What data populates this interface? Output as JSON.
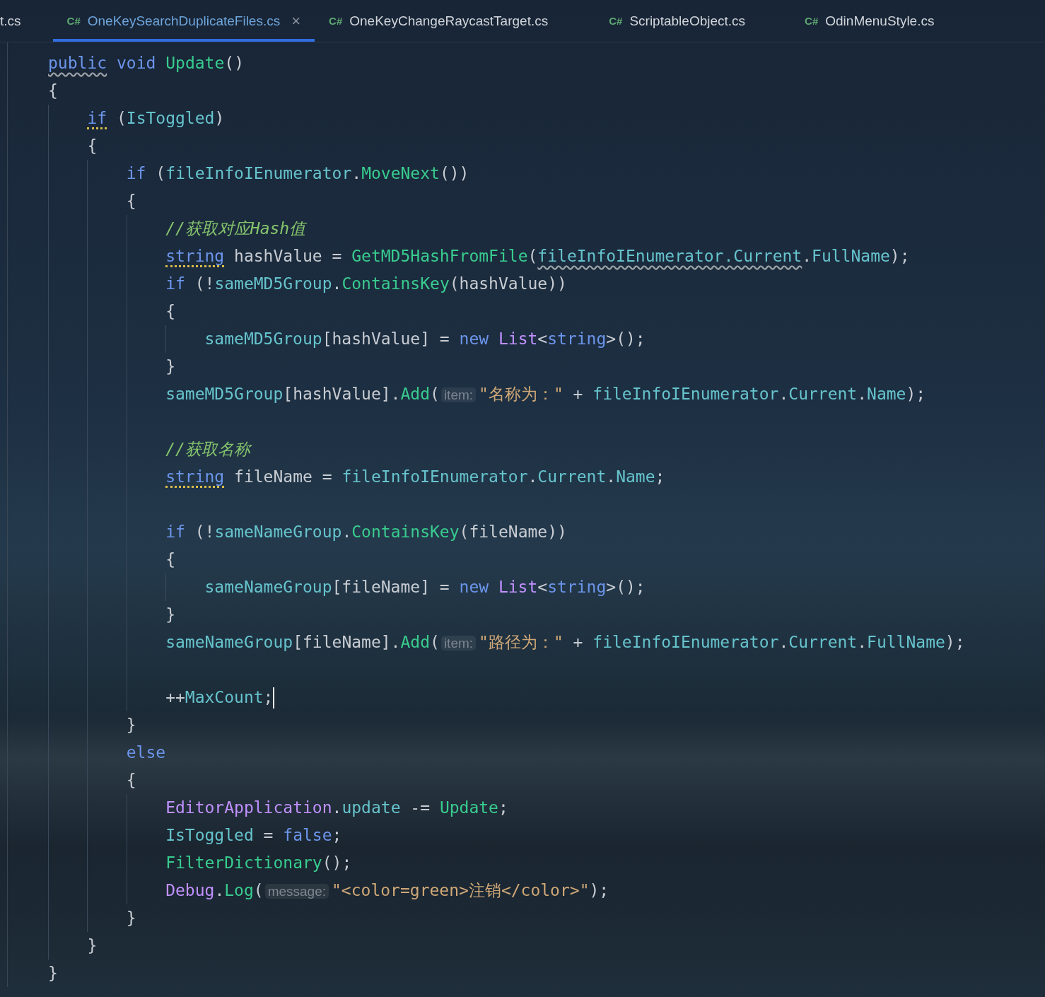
{
  "tabs": [
    {
      "label": "t.cs",
      "selected": false
    },
    {
      "lang": "C#",
      "label": "OneKeySearchDuplicateFiles.cs",
      "selected": true,
      "close": "×"
    },
    {
      "lang": "C#",
      "label": "OneKeyChangeRaycastTarget.cs",
      "selected": false
    },
    {
      "lang": "C#",
      "label": "ScriptableObject.cs",
      "selected": false
    },
    {
      "lang": "C#",
      "label": "OdinMenuStyle.cs",
      "selected": false
    }
  ],
  "code": [
    {
      "kind": "line",
      "tokens": [
        {
          "kind": "kw",
          "text": "public",
          "squiggly": true
        },
        {
          "kind": "kw",
          "text": " void"
        },
        {
          "kind": "method",
          "text": " Update"
        },
        {
          "kind": "plain",
          "text": "()"
        }
      ]
    },
    {
      "kind": "line",
      "tokens": [
        {
          "kind": "plain",
          "text": "{"
        }
      ]
    },
    {
      "kind": "block",
      "children": [
        {
          "kind": "line",
          "tokens": [
            {
              "kind": "kw",
              "text": "if",
              "dotted": true
            },
            {
              "kind": "plain",
              "text": " ("
            },
            {
              "kind": "field",
              "text": "IsToggled"
            },
            {
              "kind": "plain",
              "text": ")"
            }
          ]
        },
        {
          "kind": "line",
          "tokens": [
            {
              "kind": "plain",
              "text": "{"
            }
          ]
        },
        {
          "kind": "block",
          "children": [
            {
              "kind": "line",
              "tokens": [
                {
                  "kind": "kw",
                  "text": "if"
                },
                {
                  "kind": "plain",
                  "text": " ("
                },
                {
                  "kind": "field",
                  "text": "fileInfoIEnumerator"
                },
                {
                  "kind": "plain",
                  "text": "."
                },
                {
                  "kind": "method",
                  "text": "MoveNext"
                },
                {
                  "kind": "plain",
                  "text": "())"
                }
              ]
            },
            {
              "kind": "line",
              "tokens": [
                {
                  "kind": "plain",
                  "text": "{"
                }
              ]
            },
            {
              "kind": "block",
              "children": [
                {
                  "kind": "line",
                  "tokens": [
                    {
                      "kind": "comment",
                      "text": "//获取对应Hash值"
                    }
                  ]
                },
                {
                  "kind": "line",
                  "tokens": [
                    {
                      "kind": "kw",
                      "text": "string",
                      "dotted": true
                    },
                    {
                      "kind": "plain",
                      "text": " hashValue = "
                    },
                    {
                      "kind": "method",
                      "text": "GetMD5HashFromFile"
                    },
                    {
                      "kind": "plain",
                      "text": "("
                    },
                    {
                      "kind": "field",
                      "text": "fileInfoIEnumerator.Current",
                      "squiggly": true
                    },
                    {
                      "kind": "plain",
                      "text": "."
                    },
                    {
                      "kind": "field",
                      "text": "FullName"
                    },
                    {
                      "kind": "plain",
                      "text": ");"
                    }
                  ]
                },
                {
                  "kind": "line",
                  "tokens": [
                    {
                      "kind": "kw",
                      "text": "if"
                    },
                    {
                      "kind": "plain",
                      "text": " (!"
                    },
                    {
                      "kind": "field",
                      "text": "sameMD5Group"
                    },
                    {
                      "kind": "plain",
                      "text": "."
                    },
                    {
                      "kind": "method",
                      "text": "ContainsKey"
                    },
                    {
                      "kind": "plain",
                      "text": "(hashValue))"
                    }
                  ]
                },
                {
                  "kind": "line",
                  "tokens": [
                    {
                      "kind": "plain",
                      "text": "{"
                    }
                  ]
                },
                {
                  "kind": "block",
                  "children": [
                    {
                      "kind": "line",
                      "tokens": [
                        {
                          "kind": "field",
                          "text": "sameMD5Group"
                        },
                        {
                          "kind": "plain",
                          "text": "[hashValue] = "
                        },
                        {
                          "kind": "kw",
                          "text": "new"
                        },
                        {
                          "kind": "type",
                          "text": " List"
                        },
                        {
                          "kind": "plain",
                          "text": "<"
                        },
                        {
                          "kind": "kw",
                          "text": "string"
                        },
                        {
                          "kind": "plain",
                          "text": ">();"
                        }
                      ]
                    }
                  ]
                },
                {
                  "kind": "line",
                  "tokens": [
                    {
                      "kind": "plain",
                      "text": "}"
                    }
                  ]
                },
                {
                  "kind": "line",
                  "tokens": [
                    {
                      "kind": "field",
                      "text": "sameMD5Group"
                    },
                    {
                      "kind": "plain",
                      "text": "[hashValue]."
                    },
                    {
                      "kind": "method",
                      "text": "Add"
                    },
                    {
                      "kind": "plain",
                      "text": "("
                    },
                    {
                      "kind": "hint",
                      "text": "item:"
                    },
                    {
                      "kind": "str",
                      "text": "\"名称为：\""
                    },
                    {
                      "kind": "plain",
                      "text": " + "
                    },
                    {
                      "kind": "field",
                      "text": "fileInfoIEnumerator"
                    },
                    {
                      "kind": "plain",
                      "text": "."
                    },
                    {
                      "kind": "field",
                      "text": "Current"
                    },
                    {
                      "kind": "plain",
                      "text": "."
                    },
                    {
                      "kind": "field",
                      "text": "Name"
                    },
                    {
                      "kind": "plain",
                      "text": ");"
                    }
                  ]
                },
                {
                  "kind": "blank"
                },
                {
                  "kind": "line",
                  "tokens": [
                    {
                      "kind": "comment",
                      "text": "//获取名称"
                    }
                  ]
                },
                {
                  "kind": "line",
                  "tokens": [
                    {
                      "kind": "kw",
                      "text": "string",
                      "dotted": true
                    },
                    {
                      "kind": "plain",
                      "text": " fileName = "
                    },
                    {
                      "kind": "field",
                      "text": "fileInfoIEnumerator"
                    },
                    {
                      "kind": "plain",
                      "text": "."
                    },
                    {
                      "kind": "field",
                      "text": "Current"
                    },
                    {
                      "kind": "plain",
                      "text": "."
                    },
                    {
                      "kind": "field",
                      "text": "Name"
                    },
                    {
                      "kind": "plain",
                      "text": ";"
                    }
                  ]
                },
                {
                  "kind": "blank"
                },
                {
                  "kind": "line",
                  "tokens": [
                    {
                      "kind": "kw",
                      "text": "if"
                    },
                    {
                      "kind": "plain",
                      "text": " (!"
                    },
                    {
                      "kind": "field",
                      "text": "sameNameGroup"
                    },
                    {
                      "kind": "plain",
                      "text": "."
                    },
                    {
                      "kind": "method",
                      "text": "ContainsKey"
                    },
                    {
                      "kind": "plain",
                      "text": "(fileName))"
                    }
                  ]
                },
                {
                  "kind": "line",
                  "tokens": [
                    {
                      "kind": "plain",
                      "text": "{"
                    }
                  ]
                },
                {
                  "kind": "block",
                  "children": [
                    {
                      "kind": "line",
                      "tokens": [
                        {
                          "kind": "field",
                          "text": "sameNameGroup"
                        },
                        {
                          "kind": "plain",
                          "text": "[fileName] = "
                        },
                        {
                          "kind": "kw",
                          "text": "new"
                        },
                        {
                          "kind": "type",
                          "text": " List"
                        },
                        {
                          "kind": "plain",
                          "text": "<"
                        },
                        {
                          "kind": "kw",
                          "text": "string"
                        },
                        {
                          "kind": "plain",
                          "text": ">();"
                        }
                      ]
                    }
                  ]
                },
                {
                  "kind": "line",
                  "tokens": [
                    {
                      "kind": "plain",
                      "text": "}"
                    }
                  ]
                },
                {
                  "kind": "line",
                  "tokens": [
                    {
                      "kind": "field",
                      "text": "sameNameGroup"
                    },
                    {
                      "kind": "plain",
                      "text": "[fileName]."
                    },
                    {
                      "kind": "method",
                      "text": "Add"
                    },
                    {
                      "kind": "plain",
                      "text": "("
                    },
                    {
                      "kind": "hint",
                      "text": "item:"
                    },
                    {
                      "kind": "str",
                      "text": "\"路径为：\""
                    },
                    {
                      "kind": "plain",
                      "text": " + "
                    },
                    {
                      "kind": "field",
                      "text": "fileInfoIEnumerator"
                    },
                    {
                      "kind": "plain",
                      "text": "."
                    },
                    {
                      "kind": "field",
                      "text": "Current"
                    },
                    {
                      "kind": "plain",
                      "text": "."
                    },
                    {
                      "kind": "field",
                      "text": "FullName"
                    },
                    {
                      "kind": "plain",
                      "text": ");"
                    }
                  ]
                },
                {
                  "kind": "blank"
                },
                {
                  "kind": "line",
                  "caret": true,
                  "tokens": [
                    {
                      "kind": "plain",
                      "text": "++"
                    },
                    {
                      "kind": "field",
                      "text": "MaxCount"
                    },
                    {
                      "kind": "plain",
                      "text": ";"
                    }
                  ]
                }
              ]
            },
            {
              "kind": "line",
              "tokens": [
                {
                  "kind": "plain",
                  "text": "}"
                }
              ]
            },
            {
              "kind": "line",
              "tokens": [
                {
                  "kind": "kw",
                  "text": "else"
                }
              ]
            },
            {
              "kind": "line",
              "tokens": [
                {
                  "kind": "plain",
                  "text": "{"
                }
              ]
            },
            {
              "kind": "block",
              "children": [
                {
                  "kind": "line",
                  "tokens": [
                    {
                      "kind": "type",
                      "text": "EditorApplication"
                    },
                    {
                      "kind": "plain",
                      "text": "."
                    },
                    {
                      "kind": "field",
                      "text": "update"
                    },
                    {
                      "kind": "plain",
                      "text": " -= "
                    },
                    {
                      "kind": "method",
                      "text": "Update"
                    },
                    {
                      "kind": "plain",
                      "text": ";"
                    }
                  ]
                },
                {
                  "kind": "line",
                  "tokens": [
                    {
                      "kind": "field",
                      "text": "IsToggled"
                    },
                    {
                      "kind": "plain",
                      "text": " = "
                    },
                    {
                      "kind": "kw",
                      "text": "false"
                    },
                    {
                      "kind": "plain",
                      "text": ";"
                    }
                  ]
                },
                {
                  "kind": "line",
                  "tokens": [
                    {
                      "kind": "method",
                      "text": "FilterDictionary"
                    },
                    {
                      "kind": "plain",
                      "text": "();"
                    }
                  ]
                },
                {
                  "kind": "line",
                  "tokens": [
                    {
                      "kind": "type",
                      "text": "Debug"
                    },
                    {
                      "kind": "plain",
                      "text": "."
                    },
                    {
                      "kind": "method",
                      "text": "Log"
                    },
                    {
                      "kind": "plain",
                      "text": "("
                    },
                    {
                      "kind": "hint",
                      "text": "message:"
                    },
                    {
                      "kind": "str",
                      "text": "\"<color=green>注销</color>\""
                    },
                    {
                      "kind": "plain",
                      "text": ");"
                    }
                  ]
                }
              ]
            },
            {
              "kind": "line",
              "tokens": [
                {
                  "kind": "plain",
                  "text": "}"
                }
              ]
            }
          ]
        },
        {
          "kind": "line",
          "tokens": [
            {
              "kind": "plain",
              "text": "}"
            }
          ]
        }
      ]
    },
    {
      "kind": "line",
      "tokens": [
        {
          "kind": "plain",
          "text": "}"
        }
      ]
    }
  ]
}
